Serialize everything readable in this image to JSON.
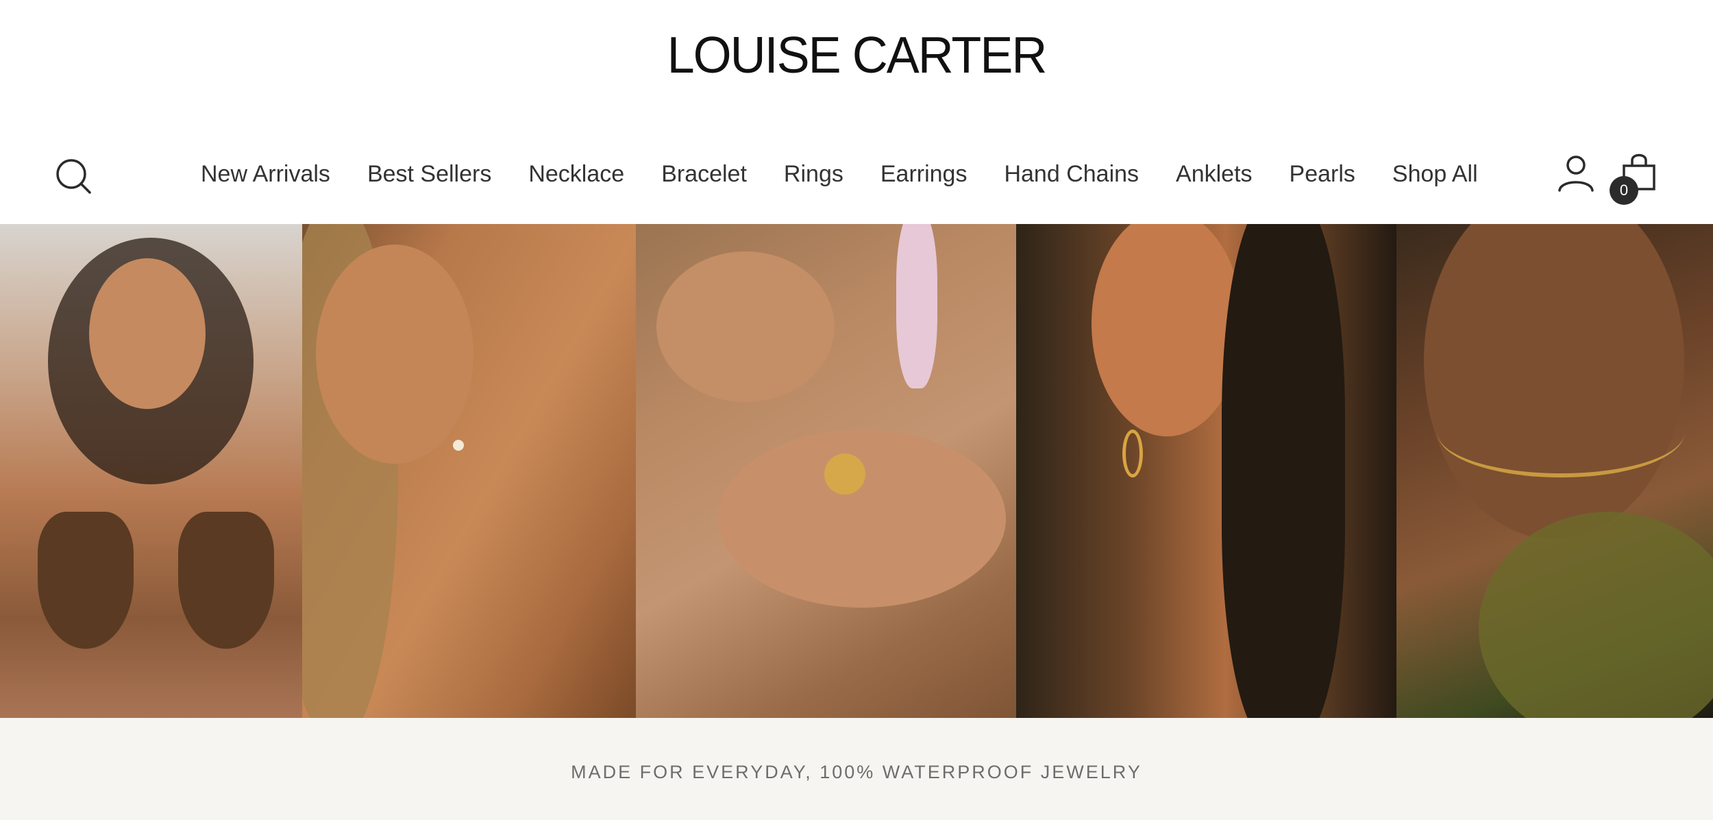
{
  "brand": {
    "logo_text": "LOUISE CARTER"
  },
  "nav": {
    "items": [
      {
        "label": "New Arrivals"
      },
      {
        "label": "Best Sellers"
      },
      {
        "label": "Necklace"
      },
      {
        "label": "Bracelet"
      },
      {
        "label": "Rings"
      },
      {
        "label": "Earrings"
      },
      {
        "label": "Hand Chains"
      },
      {
        "label": "Anklets"
      },
      {
        "label": "Pearls"
      },
      {
        "label": "Shop All"
      }
    ]
  },
  "header_icons": {
    "search": "search-icon",
    "account": "user-icon",
    "cart": "shopping-bag-icon",
    "cart_count": "0"
  },
  "hero": {
    "images": [
      {
        "subject": "model-smiling-necklace"
      },
      {
        "subject": "ear-stud-earring"
      },
      {
        "subject": "hands-with-rings"
      },
      {
        "subject": "ear-with-hoop-earrings"
      },
      {
        "subject": "neck-layered-necklaces"
      }
    ]
  },
  "tagline": {
    "text": "MADE FOR EVERYDAY, 100% WATERPROOF JEWELRY"
  },
  "colors": {
    "text": "#333333",
    "badge_bg": "#2b2b2b",
    "band_bg": "#f6f5f1",
    "tagline": "#6d6d6d"
  }
}
